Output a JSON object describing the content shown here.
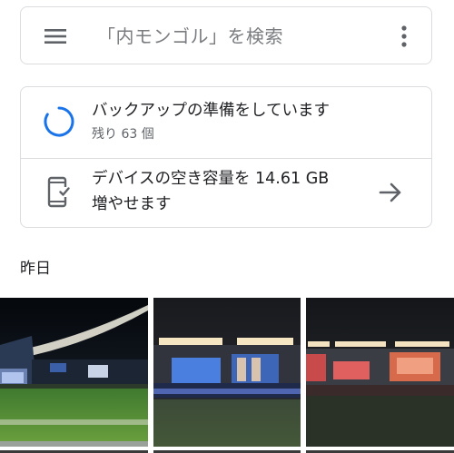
{
  "search": {
    "placeholder": "「内モンゴル」を検索",
    "menu_icon": "hamburger-menu-icon",
    "more_icon": "more-vert-icon"
  },
  "backup": {
    "title": "バックアップの準備をしています",
    "remaining": "残り 63 個",
    "icon": "progress-spinner-icon",
    "accent_color": "#1a73e8"
  },
  "storage": {
    "text_line1": "デバイスの空き容量を 14.61 GB",
    "text_line2": "増やせます",
    "icon": "phone-check-icon",
    "action_icon": "arrow-forward-icon"
  },
  "gallery": {
    "section_label": "昨日",
    "photos": [
      {
        "name": "stadium-photo-1"
      },
      {
        "name": "stadium-photo-2"
      },
      {
        "name": "stadium-photo-3"
      }
    ]
  }
}
